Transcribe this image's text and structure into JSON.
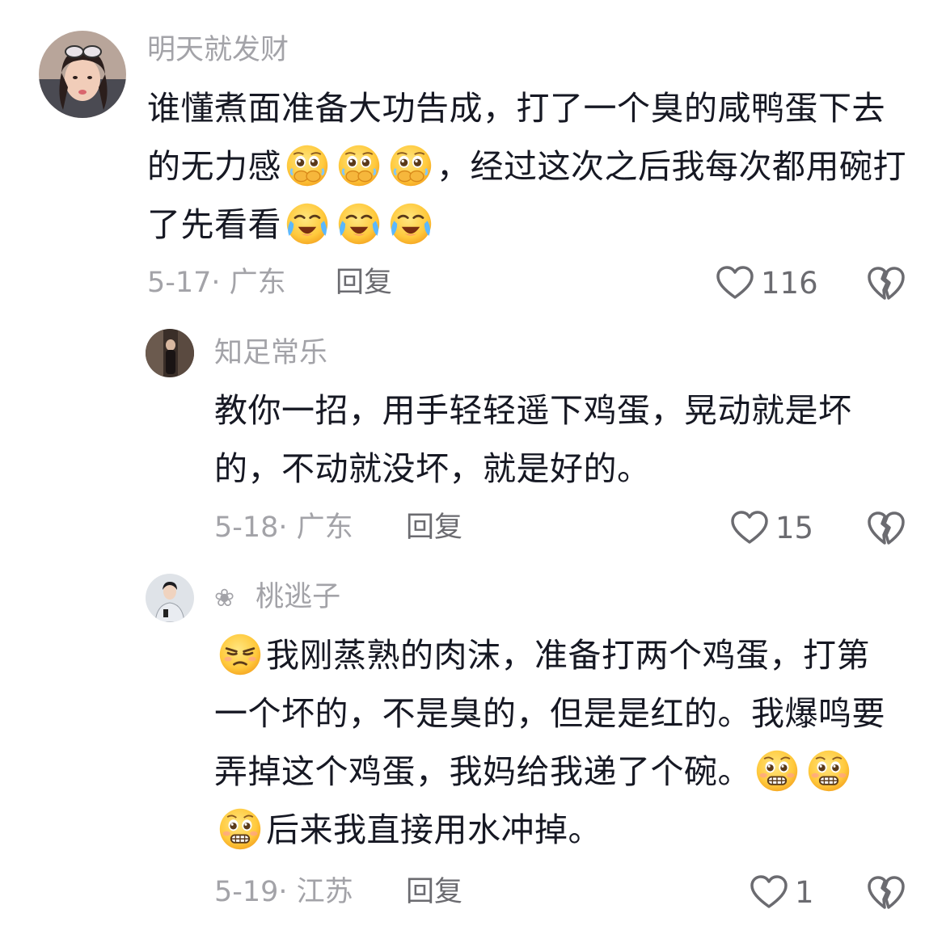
{
  "comments": [
    {
      "username": "明天就发财",
      "text_parts": [
        "谁懂煮面准备大功告成，打了一个臭的咸鸭蛋下去的无力感",
        "，经过这次之后我每次都用碗打了先看看"
      ],
      "date_location": "5-17· 广东",
      "reply_label": "回复",
      "likes": "116"
    },
    {
      "username": "知足常乐",
      "text": "教你一招，用手轻轻遥下鸡蛋，晃动就是坏的，不动就没坏，就是好的。",
      "date_location": "5-18· 广东",
      "reply_label": "回复",
      "likes": "15"
    },
    {
      "badge": "❀",
      "username": "桃逃子",
      "text_parts": [
        "我刚蒸熟的肉沫，准备打两个鸡蛋，打第一个坏的，不是臭的，但是是红的。我爆鸣要弄掉这个鸡蛋，我妈给我递了个碗。",
        "后来我直接用水冲掉。"
      ],
      "date_location": "5-19· 江苏",
      "reply_label": "回复",
      "likes": "1"
    }
  ],
  "icons": {
    "like": "heart-outline-icon",
    "dislike": "broken-heart-icon",
    "emoji_1": "pleading-cover-mouth-emoji",
    "emoji_2": "crying-laughing-emoji",
    "emoji_3": "unamused-smirk-emoji",
    "emoji_4": "pleading-grimace-emoji"
  },
  "colors": {
    "text": "#161823",
    "secondary": "#a3a3a8",
    "action": "#6b6b70",
    "emoji_yellow": "#ffc83d"
  }
}
